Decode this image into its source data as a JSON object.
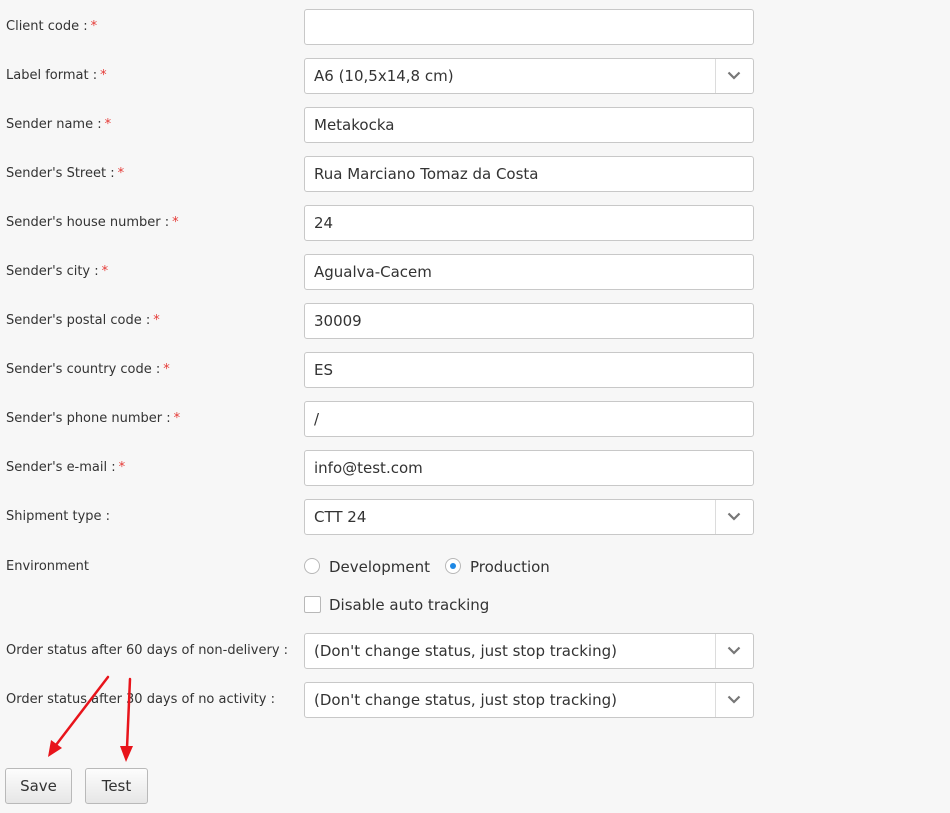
{
  "form": {
    "client_code": {
      "label": "Client code :",
      "value": ""
    },
    "label_format": {
      "label": "Label format :",
      "value": "A6 (10,5x14,8 cm)"
    },
    "sender_name": {
      "label": "Sender name :",
      "value": "Metakocka"
    },
    "sender_street": {
      "label": "Sender's Street :",
      "value": "Rua Marciano Tomaz da Costa"
    },
    "sender_house_number": {
      "label": "Sender's house number :",
      "value": "24"
    },
    "sender_city": {
      "label": "Sender's city :",
      "value": "Agualva-Cacem"
    },
    "sender_postal_code": {
      "label": "Sender's postal code :",
      "value": "30009"
    },
    "sender_country_code": {
      "label": "Sender's country code :",
      "value": "ES"
    },
    "sender_phone": {
      "label": "Sender's phone number :",
      "value": "/"
    },
    "sender_email": {
      "label": "Sender's e-mail :",
      "value": "info@test.com"
    },
    "shipment_type": {
      "label": "Shipment type :",
      "value": "CTT 24"
    },
    "environment": {
      "label": "Environment",
      "options": [
        "Development",
        "Production"
      ],
      "selected": "Production"
    },
    "disable_auto_tracking": {
      "label": "Disable auto tracking",
      "checked": false
    },
    "status_60_days": {
      "label": "Order status after 60 days of non-delivery :",
      "value": "(Don't change status, just stop tracking)"
    },
    "status_30_days": {
      "label": "Order status after 30 days of no activity :",
      "value": "(Don't change status, just stop tracking)"
    }
  },
  "required_marker": "*",
  "buttons": {
    "save": "Save",
    "test": "Test"
  },
  "colors": {
    "required": "#e53935",
    "radio_selected": "#1e88e5",
    "annotation_arrow": "#e8141b"
  }
}
